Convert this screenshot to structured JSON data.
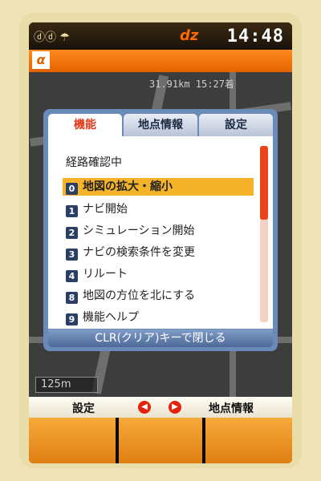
{
  "status": {
    "left_icons": "ⓓⓓ ☂",
    "logo": "dz",
    "time": "14:48"
  },
  "title": {
    "icon": "α"
  },
  "map": {
    "readout": "31.91km 15:27着",
    "scale": "125m"
  },
  "popup": {
    "tabs": [
      {
        "label": "機能",
        "active": true
      },
      {
        "label": "地点情報",
        "active": false
      },
      {
        "label": "設定",
        "active": false
      }
    ],
    "heading": "経路確認中",
    "items": [
      {
        "key": "0",
        "label": "地図の拡大・縮小",
        "selected": true
      },
      {
        "key": "1",
        "label": "ナビ開始",
        "selected": false
      },
      {
        "key": "2",
        "label": "シミュレーション開始",
        "selected": false
      },
      {
        "key": "3",
        "label": "ナビの検索条件を変更",
        "selected": false
      },
      {
        "key": "4",
        "label": "リルート",
        "selected": false
      },
      {
        "key": "8",
        "label": "地図の方位を北にする",
        "selected": false
      },
      {
        "key": "9",
        "label": "機能ヘルプ",
        "selected": false
      }
    ],
    "scroll_fraction": 0.42,
    "footer": "CLR(クリア)キーで閉じる"
  },
  "softkeys": {
    "left": "設定",
    "right": "地点情報",
    "arrow_left": "◀",
    "arrow_right": "▶"
  },
  "colors": {
    "accent": "#e46300",
    "selected": "#f5b32a",
    "tab_active": "#e23a1a"
  }
}
